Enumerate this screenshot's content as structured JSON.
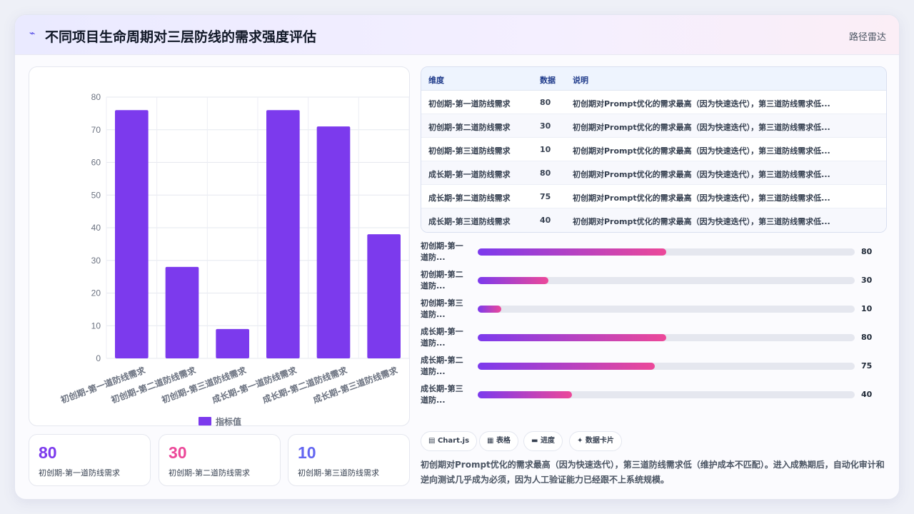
{
  "header": {
    "logo_icon": "lightning-icon",
    "title": "不同项目生命周期对三层防线的需求强度评估",
    "tag": "路径雷达"
  },
  "colors": {
    "bar": "#7c3aed",
    "accent_purple": "#7c3aed",
    "accent_pink": "#ec4899",
    "accent_indigo": "#6366f1"
  },
  "chart_data": {
    "type": "bar",
    "categories": [
      "初创期-第一道防线需求",
      "初创期-第二道防线需求",
      "初创期-第三道防线需求",
      "成长期-第一道防线需求",
      "成长期-第二道防线需求",
      "成长期-第三道防线需求"
    ],
    "series": [
      {
        "name": "指标值",
        "values": [
          76,
          28,
          9,
          76,
          71,
          38
        ]
      }
    ],
    "ylim": [
      0,
      80
    ],
    "yticks": [
      0,
      10,
      20,
      30,
      40,
      50,
      60,
      70,
      80
    ],
    "grid": true,
    "legend": "bottom"
  },
  "stats": [
    {
      "value": "80",
      "label": "初创期-第一道防线需求",
      "color": "#7c3aed"
    },
    {
      "value": "30",
      "label": "初创期-第二道防线需求",
      "color": "#ec4899"
    },
    {
      "value": "10",
      "label": "初创期-第三道防线需求",
      "color": "#6366f1"
    }
  ],
  "table": {
    "headers": [
      "维度",
      "数据",
      "说明"
    ],
    "rows": [
      {
        "dim": "初创期-第一道防线需求",
        "value": "80",
        "desc": "初创期对Prompt优化的需求最高（因为快速迭代），第三道防线需求低..."
      },
      {
        "dim": "初创期-第二道防线需求",
        "value": "30",
        "desc": "初创期对Prompt优化的需求最高（因为快速迭代），第三道防线需求低..."
      },
      {
        "dim": "初创期-第三道防线需求",
        "value": "10",
        "desc": "初创期对Prompt优化的需求最高（因为快速迭代），第三道防线需求低..."
      },
      {
        "dim": "成长期-第一道防线需求",
        "value": "80",
        "desc": "初创期对Prompt优化的需求最高（因为快速迭代），第三道防线需求低..."
      },
      {
        "dim": "成长期-第二道防线需求",
        "value": "75",
        "desc": "初创期对Prompt优化的需求最高（因为快速迭代），第三道防线需求低..."
      },
      {
        "dim": "成长期-第三道防线需求",
        "value": "40",
        "desc": "初创期对Prompt优化的需求最高（因为快速迭代），第三道防线需求低..."
      }
    ]
  },
  "progress": {
    "max": 160,
    "items": [
      {
        "label": "初创期-第一道防...",
        "value": 80
      },
      {
        "label": "初创期-第二道防...",
        "value": 30
      },
      {
        "label": "初创期-第三道防...",
        "value": 10
      },
      {
        "label": "成长期-第一道防...",
        "value": 80
      },
      {
        "label": "成长期-第二道防...",
        "value": 75
      },
      {
        "label": "成长期-第三道防...",
        "value": 40
      }
    ]
  },
  "chips": [
    {
      "icon": "bar-chart-icon",
      "label": "Chart.js"
    },
    {
      "icon": "table-icon",
      "label": "表格"
    },
    {
      "icon": "progress-icon",
      "label": "进度"
    },
    {
      "icon": "sparkle-icon",
      "label": "数据卡片"
    }
  ],
  "description": "初创期对Prompt优化的需求最高（因为快速迭代），第三道防线需求低（维护成本不匹配）。进入成熟期后，自动化审计和逆向测试几乎成为必须，因为人工验证能力已经跟不上系统规模。"
}
